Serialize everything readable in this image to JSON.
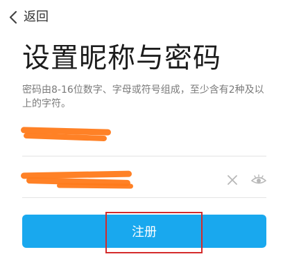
{
  "topbar": {
    "back_label": "返回",
    "back_icon": "chevron-left-icon"
  },
  "title": "设置昵称与密码",
  "description": "密码由8-16位数字、字母或符号组成，至少含有2种及以上的字符。",
  "nickname_field": {
    "value": "",
    "placeholder": ""
  },
  "password_field": {
    "value": "",
    "placeholder": "",
    "clear_icon": "close-icon",
    "toggle_icon": "eye-icon"
  },
  "register_button": {
    "label": "注册"
  },
  "colors": {
    "accent": "#19a8ee",
    "annotation": "#d42a2a",
    "redaction": "#ff7a1a"
  }
}
